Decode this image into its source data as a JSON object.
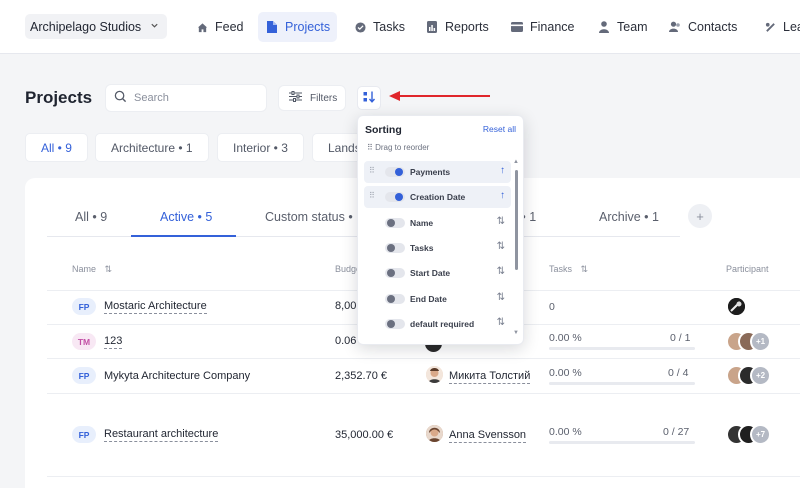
{
  "nav": {
    "workspace": "Archipelago Studios",
    "items": [
      {
        "label": "Feed",
        "icon": "home-icon"
      },
      {
        "label": "Projects",
        "icon": "document-icon",
        "active": true
      },
      {
        "label": "Tasks",
        "icon": "check-circle-icon"
      },
      {
        "label": "Reports",
        "icon": "report-icon"
      },
      {
        "label": "Finance",
        "icon": "finance-icon"
      },
      {
        "label": "Team",
        "icon": "person-icon"
      },
      {
        "label": "Contacts",
        "icon": "contacts-icon"
      },
      {
        "label": "Lea",
        "icon": "leads-icon"
      }
    ]
  },
  "header": {
    "title": "Projects",
    "search_placeholder": "Search",
    "filters_label": "Filters"
  },
  "categories": [
    {
      "label": "All • 9",
      "active": true
    },
    {
      "label": "Architecture • 1"
    },
    {
      "label": "Interior • 3"
    },
    {
      "label": "Lands"
    }
  ],
  "status_tabs": [
    {
      "label": "All • 9"
    },
    {
      "label": "Active • 5",
      "active": true
    },
    {
      "label": "Custom status • 1"
    },
    {
      "label": "d • 1"
    },
    {
      "label": "Archive • 1"
    }
  ],
  "table": {
    "columns": {
      "name": "Name",
      "budget": "Budge",
      "tasks": "Tasks",
      "participants": "Participant"
    },
    "rows": [
      {
        "badge": "FP",
        "name": "Mostaric Architecture",
        "budget": "8,00",
        "person": "",
        "percent": "",
        "tasks": "0"
      },
      {
        "badge": "TM",
        "name": "123",
        "budget": "0.06",
        "person": "",
        "percent": "0.00 %",
        "tasks": "0 / 1",
        "extra": "+1"
      },
      {
        "badge": "FP",
        "name": "Mykyta Architecture Company",
        "budget": "2,352.70 €",
        "person": "Микита Толстий",
        "percent": "0.00 %",
        "tasks": "0 / 4",
        "extra": "+2"
      },
      {
        "badge": "FP",
        "name": "Restaurant architecture",
        "budget": "35,000.00 €",
        "person": "Anna Svensson",
        "percent": "0.00 %",
        "tasks": "0 / 27",
        "extra": "+7"
      }
    ]
  },
  "sorting": {
    "title": "Sorting",
    "reset": "Reset all",
    "hint": "Drag to reorder",
    "options": [
      {
        "label": "Payments",
        "enabled": true,
        "direction": "↑"
      },
      {
        "label": "Creation Date",
        "enabled": true,
        "direction": "↑"
      },
      {
        "label": "Name",
        "enabled": false,
        "direction": "⇅"
      },
      {
        "label": "Tasks",
        "enabled": false,
        "direction": "⇅"
      },
      {
        "label": "Start Date",
        "enabled": false,
        "direction": "⇅"
      },
      {
        "label": "End Date",
        "enabled": false,
        "direction": "⇅"
      },
      {
        "label": "default required",
        "enabled": false,
        "direction": "⇅"
      }
    ]
  },
  "colors": {
    "accent": "#3461d9",
    "annotation_arrow": "#e0262b"
  }
}
